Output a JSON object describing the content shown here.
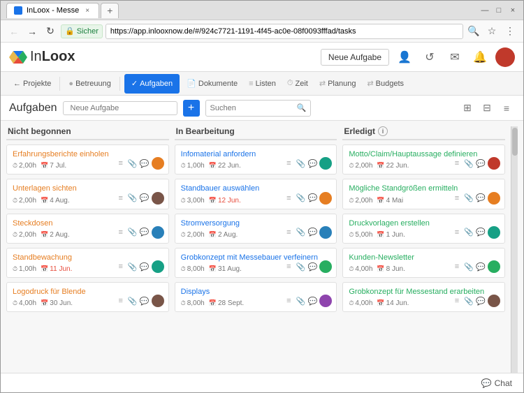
{
  "browser": {
    "tab_label": "InLoox - Messe",
    "close_label": "×",
    "minimize_label": "—",
    "maximize_label": "□",
    "close_window_label": "×",
    "url": "https://app.inlooxnow.de/#/924c7721-1191-4f45-ac0e-08f0093fffad/tasks",
    "security_label": "Sicher"
  },
  "nav": {
    "back_arrow": "←",
    "forward_arrow": "→",
    "refresh": "↻",
    "search_icon": "🔍",
    "star_icon": "☆",
    "menu_icon": "⋮"
  },
  "header": {
    "logo_text_in": "In",
    "logo_text_loox": "Loox",
    "neue_aufgabe_label": "Neue Aufgabe",
    "person_icon": "👤",
    "history_icon": "↺",
    "mail_icon": "✉",
    "bell_icon": "🔔"
  },
  "toolbar": {
    "projekte_label": "← Projekte",
    "betreuung_label": "Betreuung",
    "aufgaben_label": "Aufgaben",
    "dokumente_label": "Dokumente",
    "listen_label": "Listen",
    "zeit_label": "Zeit",
    "planung_label": "Planung",
    "budgets_label": "Budgets"
  },
  "sub_toolbar": {
    "page_title": "Aufgaben",
    "neue_aufgabe_placeholder": "Neue Aufgabe",
    "add_label": "+",
    "search_placeholder": "Suchen"
  },
  "columns": [
    {
      "id": "nicht-begonnen",
      "title": "Nicht begonnen",
      "tasks": [
        {
          "title": "Erfahrungsberichte einholen",
          "title_color": "orange",
          "hours": "2,00h",
          "date": "7 Jul.",
          "date_color": "normal",
          "avatar_class": "av-orange",
          "actions": [
            "list",
            "clip",
            "chat"
          ]
        },
        {
          "title": "Unterlagen sichten",
          "title_color": "orange",
          "hours": "2,00h",
          "date": "4 Aug.",
          "date_color": "normal",
          "avatar_class": "av-brown",
          "actions": [
            "list",
            "clip",
            "chat"
          ]
        },
        {
          "title": "Steckdosen",
          "title_color": "orange",
          "hours": "2,00h",
          "date": "2 Aug.",
          "date_color": "normal",
          "avatar_class": "av-blue",
          "actions": [
            "list",
            "clip",
            "chat"
          ]
        },
        {
          "title": "Standbewachung",
          "title_color": "orange",
          "hours": "1,00h",
          "date": "11 Jun.",
          "date_color": "red",
          "avatar_class": "av-teal",
          "actions": [
            "list",
            "clip",
            "chat"
          ]
        },
        {
          "title": "Logodruck für Blende",
          "title_color": "orange",
          "hours": "4,00h",
          "date": "30 Jun.",
          "date_color": "normal",
          "avatar_class": "av-brown",
          "actions": [
            "list",
            "clip",
            "chat"
          ]
        }
      ]
    },
    {
      "id": "in-bearbeitung",
      "title": "In Bearbeitung",
      "tasks": [
        {
          "title": "Infomaterial anfordern",
          "title_color": "blue",
          "hours": "1,00h",
          "date": "22 Jun.",
          "date_color": "normal",
          "avatar_class": "av-teal",
          "actions": [
            "list",
            "clip",
            "chat"
          ]
        },
        {
          "title": "Standbauer auswählen",
          "title_color": "blue",
          "hours": "3,00h",
          "date": "12 Jun.",
          "date_color": "red",
          "avatar_class": "av-orange",
          "actions": [
            "list",
            "clip",
            "chat"
          ]
        },
        {
          "title": "Stromversorgung",
          "title_color": "blue",
          "hours": "2,00h",
          "date": "2 Aug.",
          "date_color": "normal",
          "avatar_class": "av-blue",
          "actions": [
            "list",
            "clip",
            "chat"
          ]
        },
        {
          "title": "Grobkonzept mit Messebauer verfeinern",
          "title_color": "blue",
          "hours": "8,00h",
          "date": "31 Aug.",
          "date_color": "normal",
          "avatar_class": "av-green",
          "actions": [
            "list",
            "clip",
            "chat"
          ]
        },
        {
          "title": "Displays",
          "title_color": "blue",
          "hours": "8,00h",
          "date": "28 Sept.",
          "date_color": "normal",
          "avatar_class": "av-purple",
          "actions": [
            "list",
            "clip",
            "chat"
          ]
        }
      ]
    },
    {
      "id": "erledigt",
      "title": "Erledigt",
      "has_info": true,
      "tasks": [
        {
          "title": "Motto/Claim/Hauptaussage definieren",
          "title_color": "green",
          "hours": "2,00h",
          "date": "22 Jun.",
          "date_color": "normal",
          "avatar_class": "av-red",
          "actions": [
            "list",
            "clip",
            "chat"
          ]
        },
        {
          "title": "Mögliche Standgrößen ermitteln",
          "title_color": "green",
          "hours": "2,00h",
          "date": "4 Mai",
          "date_color": "normal",
          "avatar_class": "av-orange",
          "actions": [
            "list",
            "clip",
            "chat"
          ]
        },
        {
          "title": "Druckvorlagen erstellen",
          "title_color": "green",
          "hours": "5,00h",
          "date": "1 Jun.",
          "date_color": "normal",
          "avatar_class": "av-teal",
          "actions": [
            "list",
            "clip",
            "chat"
          ]
        },
        {
          "title": "Kunden-Newsletter",
          "title_color": "green",
          "hours": "4,00h",
          "date": "8 Jun.",
          "date_color": "normal",
          "avatar_class": "av-green",
          "actions": [
            "list",
            "clip",
            "chat"
          ]
        },
        {
          "title": "Grobkonzept für Messestand erarbeiten",
          "title_color": "green",
          "hours": "4,00h",
          "date": "14 Jun.",
          "date_color": "normal",
          "avatar_class": "av-brown",
          "actions": [
            "list",
            "clip",
            "chat"
          ]
        }
      ]
    }
  ],
  "chat": {
    "label": "Chat"
  }
}
